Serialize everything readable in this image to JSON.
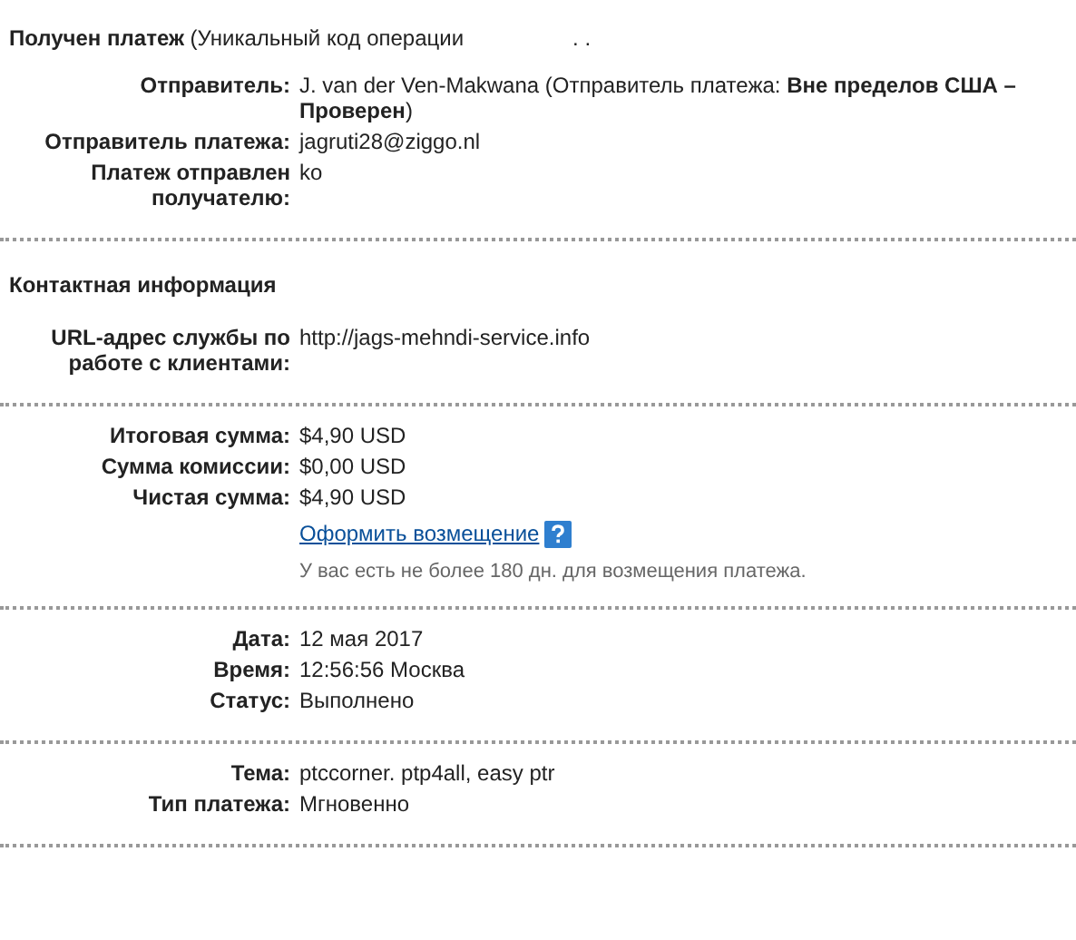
{
  "heading": {
    "title": "**Получен платеж** (Уникальный код операции",
    "redacted_tail": ". ."
  },
  "sections": [
    {
      "rows": [
        {
          "label": "Отправитель:",
          "value": "J. van der Ven-Makwana (Отправитель платежа: **Вне пределов США – Проверен**)"
        },
        {
          "label": "Отправитель платежа:",
          "value": "jagruti28@ziggo.nl"
        },
        {
          "label": "Платеж отправлен получателю:",
          "value": "ko"
        }
      ]
    },
    {
      "title": "Контактная информация",
      "rows": [
        {
          "label": "URL-адрес службы по работе с клиентами:",
          "value": "http://jags-mehndi-service.info"
        }
      ]
    },
    {
      "rows": [
        {
          "label": "Итоговая сумма:",
          "value": "$4,90 USD"
        },
        {
          "label": "Сумма комиссии:",
          "value": "$0,00 USD"
        },
        {
          "label": "Чистая сумма:",
          "value": "$4,90 USD"
        }
      ],
      "refund": {
        "link": "Оформить возмещение",
        "note": "У вас есть не более 180 дн. для возмещения платежа."
      }
    },
    {
      "rows": [
        {
          "label": "Дата:",
          "value": "12 мая 2017"
        },
        {
          "label": "Время:",
          "value": "12:56:56 Москва"
        },
        {
          "label": "Статус:",
          "value": "Выполнено"
        }
      ]
    },
    {
      "rows": [
        {
          "label": "Тема:",
          "value": "ptccorner. ptp4all, easy ptr"
        },
        {
          "label": "Тип платежа:",
          "value": "Мгновенно"
        }
      ]
    }
  ]
}
